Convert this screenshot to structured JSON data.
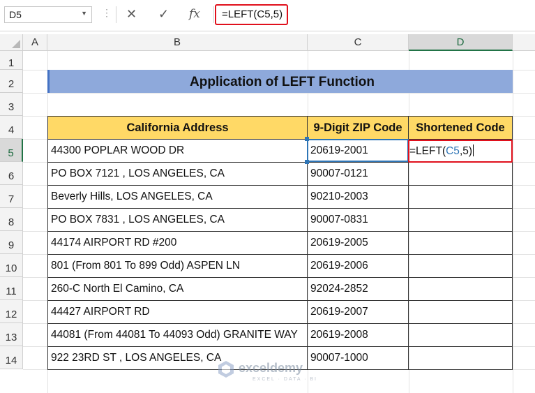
{
  "formula_bar": {
    "name_box": "D5",
    "cancel_icon": "✕",
    "enter_icon": "✓",
    "fx_label": "fx",
    "formula": "=LEFT(C5,5)"
  },
  "columns": [
    "A",
    "B",
    "C",
    "D"
  ],
  "rows": [
    "1",
    "2",
    "3",
    "4",
    "5",
    "6",
    "7",
    "8",
    "9",
    "10",
    "11",
    "12",
    "13",
    "14"
  ],
  "selected": {
    "column": "D",
    "row": "5",
    "reference_cell": "C5"
  },
  "table": {
    "title": "Application of LEFT Function",
    "headers": [
      "California Address",
      "9-Digit ZIP Code",
      "Shortened Code"
    ],
    "rows": [
      {
        "address": "44300 POPLAR WOOD DR",
        "zip": "20619-2001",
        "short": ""
      },
      {
        "address": "PO BOX 7121 , LOS ANGELES, CA",
        "zip": "90007-0121",
        "short": ""
      },
      {
        "address": "Beverly Hills,  LOS ANGELES, CA",
        "zip": "90210-2003",
        "short": ""
      },
      {
        "address": "PO BOX 7831 , LOS ANGELES, CA",
        "zip": "90007-0831",
        "short": ""
      },
      {
        "address": "44174 AIRPORT RD #200",
        "zip": "20619-2005",
        "short": ""
      },
      {
        "address": "801 (From 801 To 899 Odd) ASPEN LN",
        "zip": "20619-2006",
        "short": ""
      },
      {
        "address": "260-C North El Camino, CA",
        "zip": "92024-2852",
        "short": ""
      },
      {
        "address": "44427 AIRPORT RD",
        "zip": "20619-2007",
        "short": ""
      },
      {
        "address": "44081 (From 44081 To 44093 Odd) GRANITE WAY",
        "zip": "20619-2008",
        "short": ""
      },
      {
        "address": "922 23RD ST , LOS ANGELES, CA",
        "zip": "90007-1000",
        "short": ""
      }
    ],
    "editing_cell": {
      "prefix": "=LEFT(",
      "ref": "C5",
      "suffix": ",5)"
    }
  },
  "watermark": {
    "name": "exceldemy",
    "tagline": "EXCEL · DATA · BI"
  },
  "colors": {
    "title_fill": "#8ea9db",
    "header_fill": "#ffd966",
    "highlight_red": "#e0101c",
    "selection_blue": "#2e75b6",
    "excel_green": "#217346"
  },
  "icons": {
    "name_box_dropdown": "chevron-down-icon",
    "cancel": "close-icon",
    "enter": "checkmark-icon",
    "insert_function": "fx-icon"
  }
}
